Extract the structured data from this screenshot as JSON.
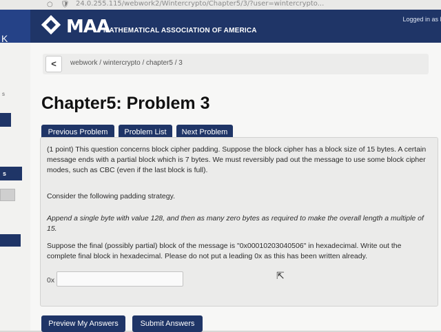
{
  "browser": {
    "url": "24.0.255.115/webwork2/Wintercrypto/Chapter5/3/?user=wintercrypto..."
  },
  "header": {
    "logo": "MAA",
    "org_name": "MATHEMATICAL ASSOCIATION OF AMERICA",
    "logged_in": "Logged in as F",
    "left_tab": "K"
  },
  "breadcrumb": {
    "back": "<",
    "path": "webwork / wintercrypto / chapter5 / 3"
  },
  "page_title": "Chapter5: Problem 3",
  "nav": {
    "previous": "Previous Problem",
    "list": "Problem List",
    "next": "Next Problem"
  },
  "problem": {
    "intro": "(1 point) This question concerns block cipher padding. Suppose the block cipher has a block size of 15 bytes. A certain message ends with a partial block which is 7 bytes. We must reversibly pad out the message to use some block cipher modes, such as CBC (even if the last block is full).",
    "consider": "Consider the following padding strategy.",
    "strategy": "Append a single byte with value 128, and then as many zero bytes as required to make the overall length a multiple of 15.",
    "question": "Suppose the final (possibly partial) block of the message is \"0x00010203040506\" in hexadecimal. Write out the complete final block in hexadecimal. Please do not put a leading 0x as this has been written already.",
    "answer_prefix": "0x",
    "answer_value": ""
  },
  "actions": {
    "preview": "Preview My Answers",
    "submit": "Submit Answers"
  }
}
